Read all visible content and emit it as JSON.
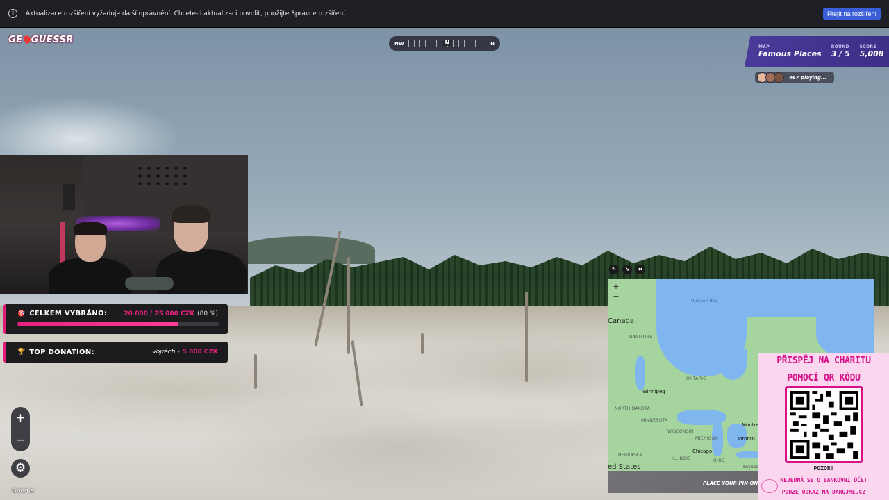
{
  "extension_bar": {
    "message": "Aktualizace rozšíření vyžaduje další oprávnění. Chcete-li aktualizaci povolit, použijte Správce rozšíření.",
    "button_label": "Přejít na rozšíření",
    "info_icon": "info-icon"
  },
  "logo": {
    "left": "GE",
    "right": "GUESSR"
  },
  "compass": {
    "left": "NW",
    "center": "N",
    "right": "N"
  },
  "game": {
    "map_label": "MAP",
    "map_value": "Famous Places",
    "round_label": "ROUND",
    "round_value": "3 / 5",
    "score_label": "SCORE",
    "score_value": "5,008",
    "playing_text": "467 playing..."
  },
  "charity": {
    "total_label": "CELKEM VYBRÁNO:",
    "total_icon": "🎯",
    "total_amount": "20 000 / 25 000 CZK",
    "total_percent": "(80 %)",
    "progress": 0.8,
    "top_label": "TOP DONATION:",
    "top_icon": "🏆",
    "top_name": "Vojtěch -",
    "top_amount": "5 800 CZK"
  },
  "controls": {
    "zoom_in": "+",
    "zoom_out": "−",
    "settings_icon": "⚙",
    "google": "Google"
  },
  "map": {
    "tools": [
      "↖",
      "↘",
      "⇔"
    ],
    "zoom_in": "+",
    "zoom_out": "−",
    "labels": {
      "hudson_bay": "Hudson Bay",
      "canada": "Canada",
      "manitoba": "MANITOBA",
      "ontario": "ONTARIO",
      "winnipeg": "Winnipeg",
      "north_dakota": "NORTH DAKOTA",
      "minnesota": "MINNESOTA",
      "wisconsin": "WISCONSIN",
      "michigan": "MICHIGAN",
      "nebraska": "NEBRASKA",
      "illinois": "ILLINOIS",
      "ohio": "OHIO",
      "toronto": "Toronto",
      "montreal": "Montre",
      "chicago": "Chicago",
      "united_states": "ed States",
      "keyboard": "Keyboa"
    },
    "place_pin": "PLACE YOUR PIN ON T"
  },
  "qr": {
    "line1": "PŘISPĚJ NA CHARITU",
    "line2": "POMOCÍ QR KÓDU",
    "warning": "POZOR!",
    "note1": "NEJEDNÁ SE O BANKOVNÍ ÚČET",
    "note2": "POUZE ODKAZ NA DARUJME.CZ"
  }
}
